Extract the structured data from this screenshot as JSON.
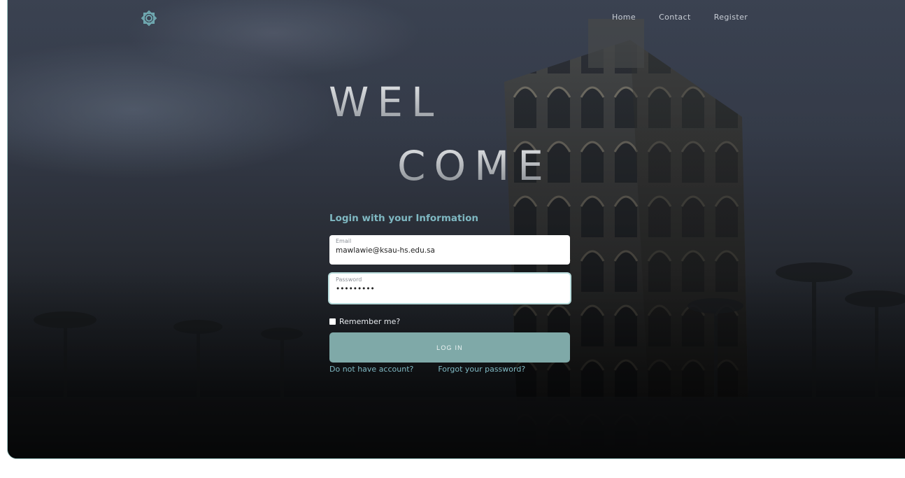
{
  "nav": {
    "items": [
      "Home",
      "Contact",
      "Register"
    ]
  },
  "hero": {
    "line1": "WEL",
    "line2": "COME"
  },
  "form": {
    "subtitle": "Login with your Information",
    "email": {
      "label": "Email",
      "value": "mawlawie@ksau-hs.edu.sa"
    },
    "password": {
      "label": "Password",
      "value": "•••••••••"
    },
    "remember_label": "Remember me?",
    "login_label": "LOG IN",
    "no_account_link": "Do not have account?",
    "forgot_link": "Forgot your password?"
  },
  "colors": {
    "accent": "#7fb8c2",
    "button": "#7fa9a8",
    "frame_border": "#9fc9c6"
  },
  "icons": {
    "logo": "ornament-logo-icon"
  }
}
